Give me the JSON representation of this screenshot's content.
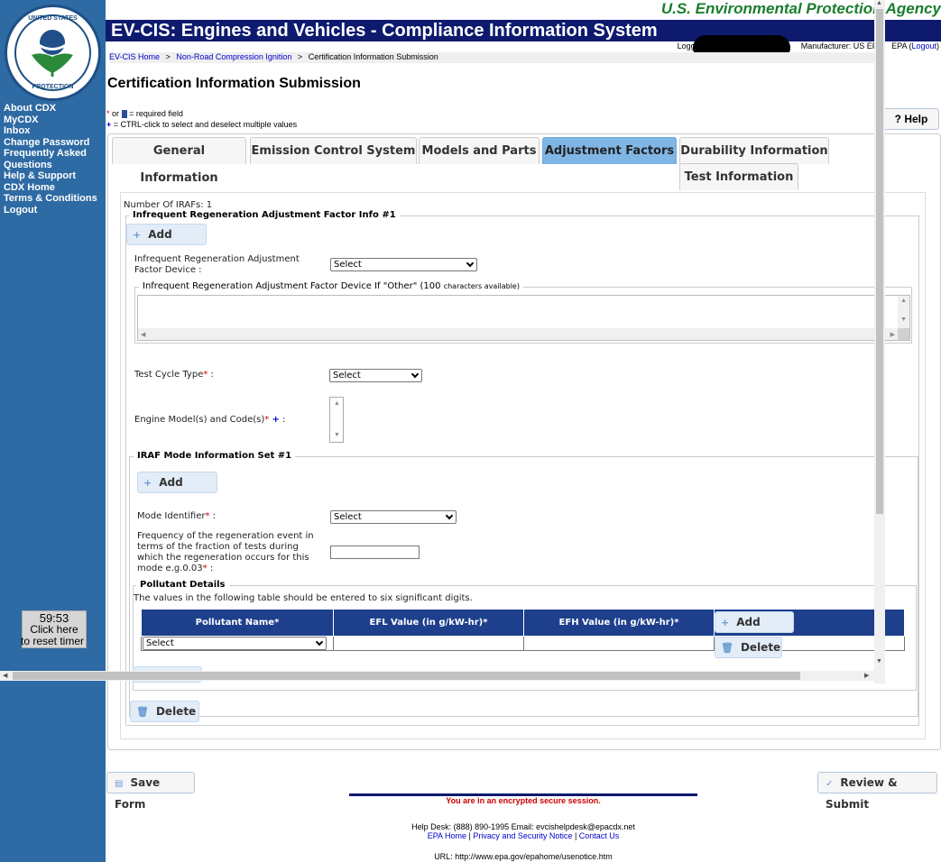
{
  "agency_title": "U.S. Environmental Protection Agency",
  "seal": {
    "top_text": "UNITED STATES",
    "bottom_text": "PROTECTION"
  },
  "app_title": "EV-CIS: Engines and Vehicles - Compliance Information System",
  "user": {
    "logged_label": "Logged",
    "manufacturer_label": "Manufacturer: US EPA",
    "manufacturer_extra": "EPA",
    "logout_label": "Logout"
  },
  "breadcrumb": {
    "home": "EV-CIS Home",
    "sep": ">",
    "level2": "Non-Road Compression Ignition",
    "current": "Certification Information Submission"
  },
  "sidebar": {
    "items": [
      "About CDX",
      "MyCDX",
      "Inbox",
      "Change Password",
      "Frequently Asked Questions",
      "Help & Support",
      "CDX Home",
      "Terms & Conditions",
      "Logout"
    ],
    "timer": {
      "time": "59:53",
      "line1": "Click here",
      "line2": "to reset timer"
    }
  },
  "page_title": "Certification Information Submission",
  "legend": {
    "or": "or",
    "required": "= required field",
    "multi": "= CTRL-click to select and deselect multiple values"
  },
  "help_label": "? Help",
  "tabs": [
    {
      "label": "General Information",
      "active": false
    },
    {
      "label": "Emission Control System",
      "active": false
    },
    {
      "label": "Models and Parts",
      "active": false
    },
    {
      "label": "Adjustment Factors",
      "active": true
    },
    {
      "label": "Durability Information",
      "active": false
    },
    {
      "label": "Test Information",
      "active": false
    }
  ],
  "form": {
    "num_irafs": "Number Of IRAFs: 1",
    "iraf_info_legend": "Infrequent Regeneration Adjustment Factor Info #1",
    "add_label": "Add",
    "delete_label": "Delete",
    "device_label": "Infrequent Regeneration Adjustment Factor Device :",
    "device_value": "Select",
    "other_label": "Infrequent Regeneration Adjustment Factor Device If \"Other\" (100",
    "other_available": "characters available)",
    "test_cycle_label": "Test Cycle Type",
    "test_cycle_value": "Select",
    "engine_models_label": "Engine Model(s) and Code(s)",
    "mode_set_legend": "IRAF Mode Information Set #1",
    "mode_identifier_label": "Mode Identifier",
    "mode_identifier_value": "Select",
    "frequency_label": "Frequency of the regeneration event in terms of the fraction of tests during which the regeneration occurs for this mode e.g.0.03",
    "pollutant_legend": "Pollutant Details",
    "pollutant_note": "The values in the following table should be entered to six significant digits.",
    "table_headers": [
      "Pollutant Name",
      "EFL Value (in g/kW-hr)",
      "EFH Value (in g/kW-hr)"
    ],
    "pollutant_select": "Select"
  },
  "bottom": {
    "save_label": "Save Form",
    "submit_label": "Review & Submit"
  },
  "footer": {
    "secure": "You are in an encrypted secure session.",
    "helpdesk": "Help Desk: (888) 890-1995   Email: evcishelpdesk@epacdx.net",
    "links": [
      "EPA Home",
      "Privacy and Security Notice",
      "Contact Us"
    ],
    "url": "URL: http://www.epa.gov/epahome/usenotice.htm"
  }
}
